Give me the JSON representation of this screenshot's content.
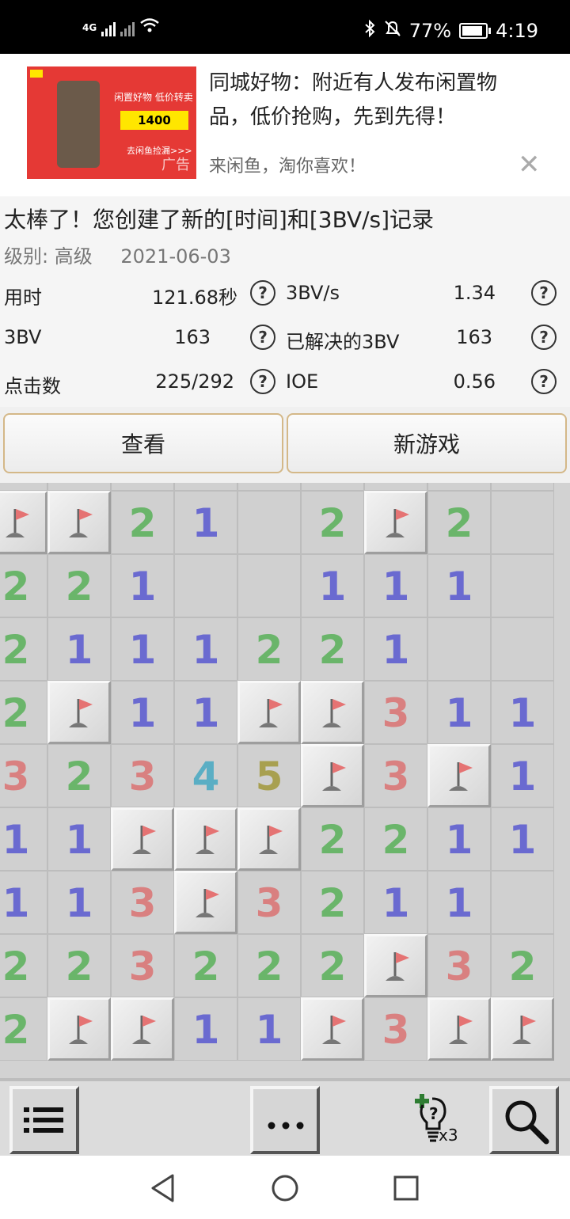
{
  "status_bar": {
    "network": "4G",
    "battery": "77%",
    "time": "4:19"
  },
  "ad": {
    "image_text": {
      "headline": "闲置好物 低价转卖",
      "price": "1400",
      "cta": "去闲鱼捡漏>>>",
      "tag": "广告"
    },
    "title": "同城好物：附近有人发布闲置物品，低价抢购，先到先得！",
    "subtitle": "来闲鱼，淘你喜欢！",
    "close_icon": "close-icon"
  },
  "result": {
    "title": "太棒了！您创建了新的[时间]和[3BV/s]记录",
    "level": "级别: 高级",
    "date": "2021-06-03",
    "stats": [
      {
        "label": "用时",
        "value": "121.68秒"
      },
      {
        "label": "3BV/s",
        "value": "1.34"
      },
      {
        "label": "3BV",
        "value": "163"
      },
      {
        "label": "已解决的3BV",
        "value": "163"
      },
      {
        "label": "点击数",
        "value": "225/292"
      },
      {
        "label": "IOE",
        "value": "0.56"
      }
    ],
    "help_glyph": "?"
  },
  "buttons": {
    "view": "查看",
    "new_game": "新游戏"
  },
  "board": {
    "rows": [
      [
        "F",
        "F",
        "2",
        "1",
        "",
        "2",
        "F",
        "2",
        ""
      ],
      [
        "2",
        "2",
        "1",
        "",
        "",
        "1",
        "1",
        "1",
        ""
      ],
      [
        "2",
        "1",
        "1",
        "1",
        "2",
        "2",
        "1",
        "",
        ""
      ],
      [
        "2",
        "F",
        "1",
        "1",
        "F",
        "F",
        "3",
        "1",
        "1"
      ],
      [
        "3",
        "2",
        "3",
        "4",
        "5",
        "F",
        "3",
        "F",
        "1"
      ],
      [
        "1",
        "1",
        "F",
        "F",
        "F",
        "2",
        "2",
        "1",
        "1"
      ],
      [
        "1",
        "1",
        "3",
        "F",
        "3",
        "2",
        "1",
        "1",
        ""
      ],
      [
        "2",
        "2",
        "3",
        "2",
        "2",
        "2",
        "F",
        "3",
        "2"
      ],
      [
        "2",
        "F",
        "F",
        "1",
        "1",
        "F",
        "3",
        "F",
        "F"
      ]
    ],
    "number_colors": {
      "1": "#6a6ad0",
      "2": "#6ab56a",
      "3": "#d98080",
      "4": "#5aaec4",
      "5": "#a8a050"
    }
  },
  "toolbar": {
    "hint_count": "x3",
    "icons": [
      "list-icon",
      "more-icon",
      "hint-bulb-icon",
      "search-icon"
    ]
  },
  "navbar": {
    "icons": [
      "back-icon",
      "home-icon",
      "recents-icon"
    ]
  }
}
